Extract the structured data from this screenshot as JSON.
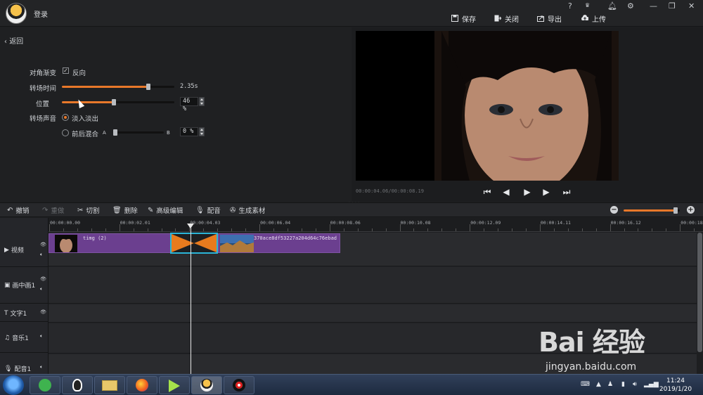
{
  "header": {
    "login": "登录",
    "buttons": [
      {
        "label": "保存",
        "icon": "save-icon"
      },
      {
        "label": "关闭",
        "icon": "close-door-icon"
      },
      {
        "label": "导出",
        "icon": "export-icon"
      },
      {
        "label": "上传",
        "icon": "upload-icon"
      }
    ],
    "window_controls": [
      "?",
      "VIP",
      "bell",
      "gear",
      "minimize",
      "restore",
      "close"
    ]
  },
  "panel": {
    "back": "返回",
    "diagonal_label": "对角渐变",
    "reverse_label": "反向",
    "reverse_checked": true,
    "duration_label": "转场时间",
    "duration_value": "2.35s",
    "duration_fraction": 0.77,
    "position_label": "位置",
    "position_value": "46 %",
    "position_fraction": 0.46,
    "sound_label": "转场声音",
    "fade_label": "淡入淡出",
    "mix_label": "前后混合",
    "mix_a": "A",
    "mix_b": "B",
    "mix_value": "0 %",
    "mix_fraction": 0.0
  },
  "preview": {
    "timecode": "00:00:04.06/00:00:08.19"
  },
  "toolbar": {
    "undo": "撤销",
    "redo": "重做",
    "cut": "切割",
    "delete": "删除",
    "advanced": "高级编辑",
    "dub": "配音",
    "generate": "生成素材",
    "zoom_fraction": 0.92
  },
  "ruler": {
    "labels": [
      "00:00:00.00",
      "00:00:02.01",
      "00:00:04.03",
      "00:00:06.04",
      "00:00:08.06",
      "00:00:10.08",
      "00:00:12.09",
      "00:00:14.11",
      "00:00:16.12",
      "00:00:18."
    ]
  },
  "tracks": [
    {
      "name": "视频",
      "icon": "video-track-icon"
    },
    {
      "name": "画中画1",
      "icon": "pip-track-icon"
    },
    {
      "name": "文字1",
      "icon": "text-track-icon"
    },
    {
      "name": "音乐1",
      "icon": "music-track-icon"
    },
    {
      "name": "配音1",
      "icon": "mic-track-icon"
    }
  ],
  "clips": {
    "clip1_label": "timg (2)",
    "clip2_label": "370ace8df53227a204d64c76ebad"
  },
  "taskbar": {
    "time": "11:24",
    "date": "2019/1/20"
  },
  "watermark": {
    "brand": "Bai 经验",
    "url": "jingyan.baidu.com"
  }
}
